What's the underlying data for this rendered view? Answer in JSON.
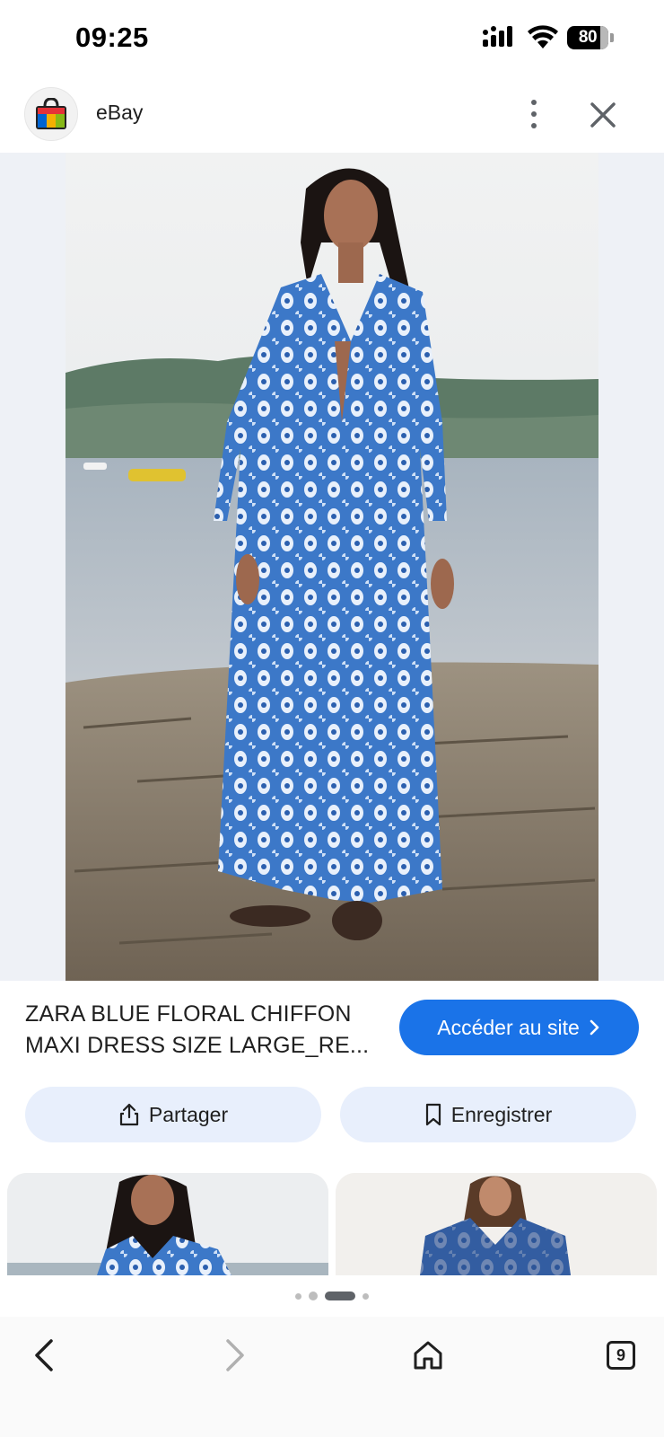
{
  "status_bar": {
    "time": "09:25",
    "battery": "80"
  },
  "header": {
    "site_name": "eBay",
    "logo_icon": "ebay-shopping-bag-icon",
    "more_icon": "more-vertical-icon",
    "close_icon": "close-icon"
  },
  "product": {
    "image_description_icon": "product-photo",
    "title": "ZARA BLUE FLORAL CHIFFON MAXI DRESS SIZE LARGE_RE...",
    "visit_label": "Accéder au site"
  },
  "actions": {
    "share_label": "Partager",
    "save_label": "Enregistrer"
  },
  "pager": {
    "active_index": 2,
    "dot_count": 4
  },
  "nav": {
    "tabs_count": "9"
  },
  "colors": {
    "accent": "#1a73e8",
    "chip_bg": "#e8effc",
    "image_bg": "#eef1f6"
  }
}
